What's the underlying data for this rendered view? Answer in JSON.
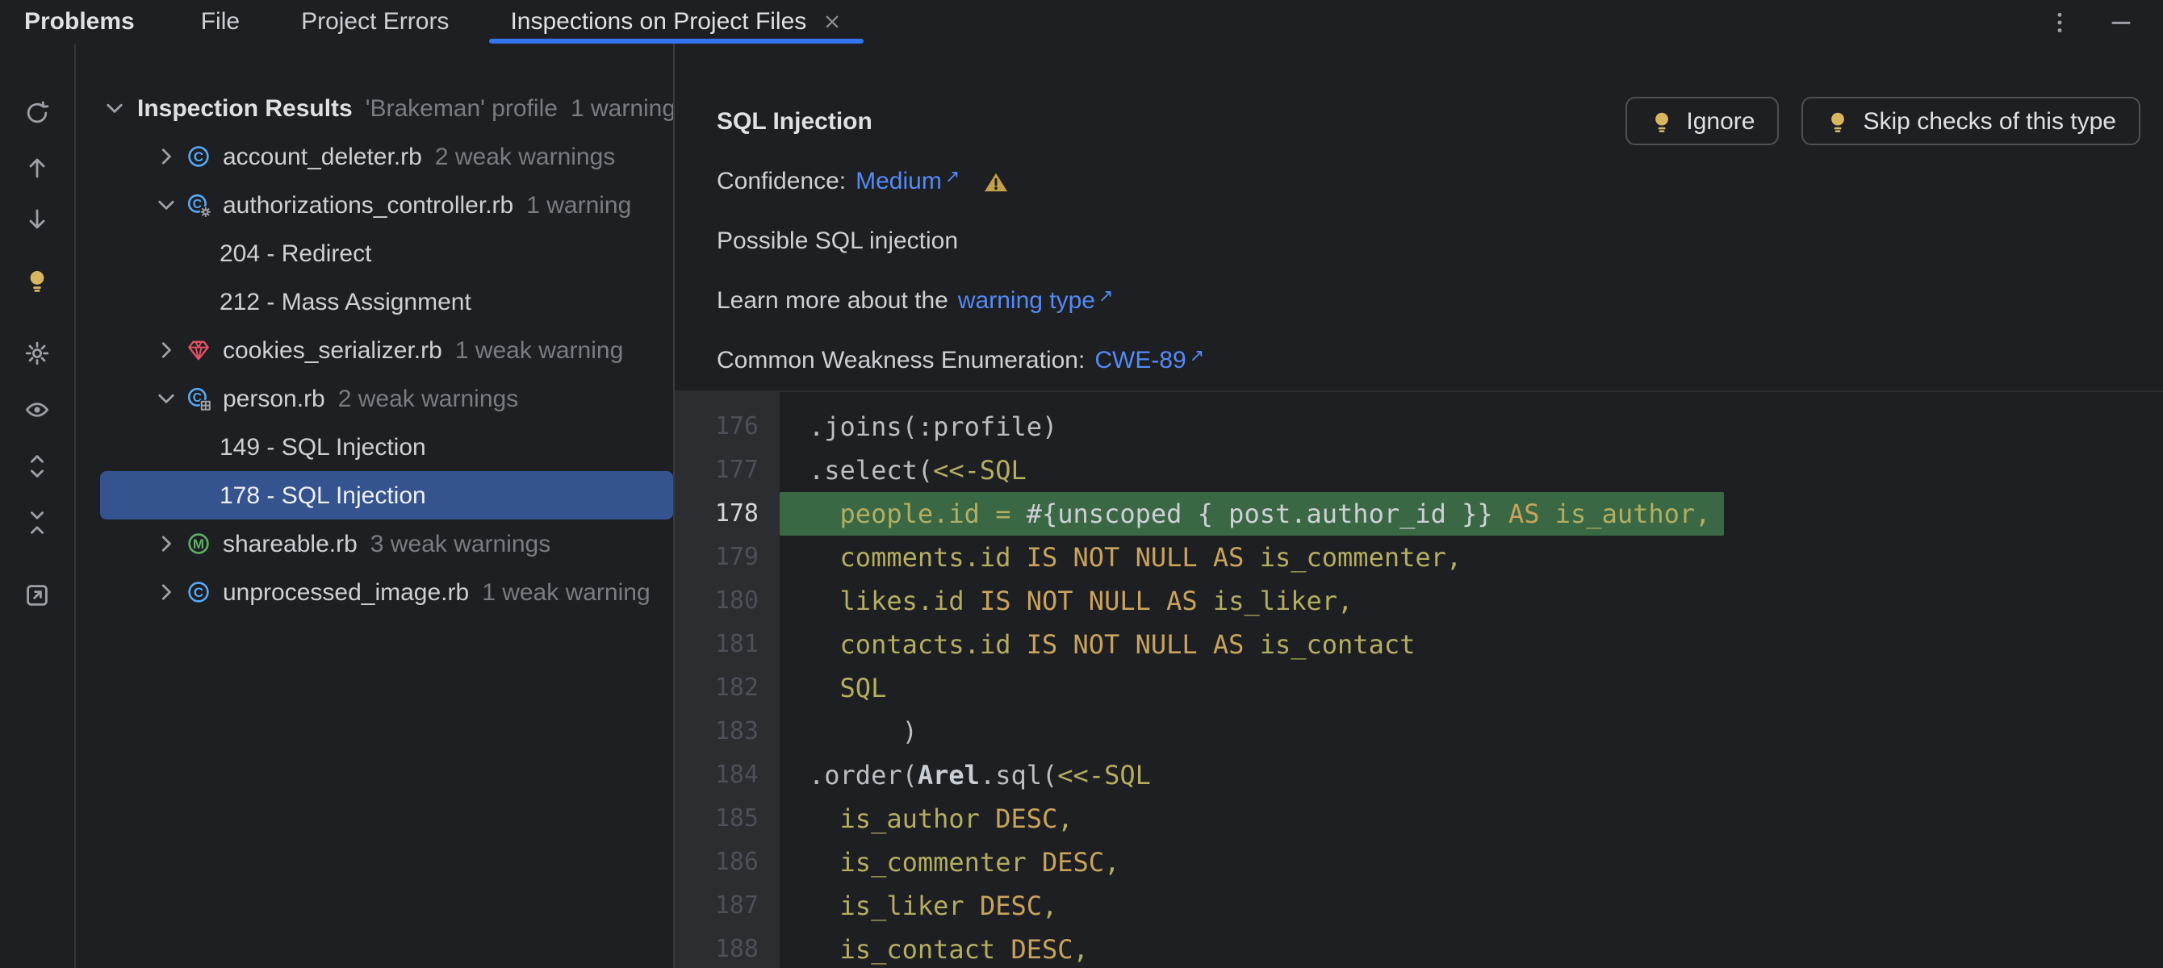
{
  "window": {
    "title": "Problems"
  },
  "tabs": [
    {
      "label": "File",
      "active": false
    },
    {
      "label": "Project Errors",
      "active": false
    },
    {
      "label": "Inspections on Project Files",
      "active": true,
      "closable": true
    }
  ],
  "window_controls": {
    "more": "kebab-menu",
    "hide": "minimize"
  },
  "toolbar": {
    "icons": [
      "refresh",
      "arrow-up",
      "arrow-down",
      "lightbulb",
      "settings",
      "preview",
      "expand-all",
      "collapse-all",
      "open-in-editor"
    ]
  },
  "tree": {
    "root": {
      "label": "Inspection Results",
      "profile": "'Brakeman' profile",
      "summary": "1 warning",
      "expanded": true
    },
    "files": [
      {
        "name": "account_deleter.rb",
        "icon": "ruby-class",
        "count": "2 weak warnings",
        "expanded": false,
        "children": []
      },
      {
        "name": "authorizations_controller.rb",
        "icon": "ruby-controller",
        "count": "1 warning",
        "expanded": true,
        "children": [
          {
            "label": "204 - Redirect"
          },
          {
            "label": "212 - Mass Assignment"
          }
        ]
      },
      {
        "name": "cookies_serializer.rb",
        "icon": "ruby-gem",
        "count": "1 weak warning",
        "expanded": false,
        "children": []
      },
      {
        "name": "person.rb",
        "icon": "ruby-model",
        "count": "2 weak warnings",
        "expanded": true,
        "children": [
          {
            "label": "149 - SQL Injection"
          },
          {
            "label": "178 - SQL Injection",
            "selected": true
          }
        ]
      },
      {
        "name": "shareable.rb",
        "icon": "ruby-module",
        "count": "3 weak warnings",
        "expanded": false,
        "children": []
      },
      {
        "name": "unprocessed_image.rb",
        "icon": "ruby-class",
        "count": "1 weak warning",
        "expanded": false,
        "children": []
      }
    ]
  },
  "details": {
    "title": "SQL Injection",
    "actions": [
      {
        "label": "Ignore",
        "icon": "lightbulb"
      },
      {
        "label": "Skip checks of this type",
        "icon": "lightbulb"
      }
    ],
    "confidence": {
      "label": "Confidence:",
      "value": "Medium",
      "external": "↗",
      "severity_icon": "weak-warning-triangle"
    },
    "message": "Possible SQL injection",
    "learn_more": {
      "prefix": "Learn more about the",
      "link": "warning type",
      "external": "↗"
    },
    "cwe": {
      "label": "Common Weakness Enumeration:",
      "link": "CWE-89",
      "external": "↗"
    }
  },
  "editor": {
    "lines": [
      {
        "no": 176,
        "segs": [
          [
            "d",
            ".joins(:profile)"
          ]
        ]
      },
      {
        "no": 177,
        "segs": [
          [
            "d",
            ".select("
          ],
          [
            "s",
            "<<-SQL"
          ]
        ]
      },
      {
        "no": 178,
        "hl": true,
        "segs": [
          [
            "s",
            "  people.id = "
          ],
          [
            "i",
            "#{unscoped { post.author_id }}"
          ],
          [
            "k",
            " AS"
          ],
          [
            "s",
            " is_author,"
          ]
        ]
      },
      {
        "no": 179,
        "segs": [
          [
            "s",
            "  comments.id "
          ],
          [
            "k",
            "IS NOT NULL AS"
          ],
          [
            "s",
            " is_commenter,"
          ]
        ]
      },
      {
        "no": 180,
        "segs": [
          [
            "s",
            "  likes.id "
          ],
          [
            "k",
            "IS NOT NULL AS"
          ],
          [
            "s",
            " is_liker,"
          ]
        ]
      },
      {
        "no": 181,
        "segs": [
          [
            "s",
            "  contacts.id "
          ],
          [
            "k",
            "IS NOT NULL AS"
          ],
          [
            "s",
            " is_contact"
          ]
        ]
      },
      {
        "no": 182,
        "segs": [
          [
            "s",
            "  SQL"
          ]
        ]
      },
      {
        "no": 183,
        "segs": [
          [
            "d",
            "      )"
          ]
        ]
      },
      {
        "no": 184,
        "segs": [
          [
            "d",
            ".order("
          ],
          [
            "c",
            "Arel"
          ],
          [
            "d",
            ".sql("
          ],
          [
            "s",
            "<<-SQL"
          ]
        ]
      },
      {
        "no": 185,
        "segs": [
          [
            "s",
            "  is_author "
          ],
          [
            "k",
            "DESC"
          ],
          [
            "s",
            ","
          ]
        ]
      },
      {
        "no": 186,
        "segs": [
          [
            "s",
            "  is_commenter "
          ],
          [
            "k",
            "DESC"
          ],
          [
            "s",
            ","
          ]
        ]
      },
      {
        "no": 187,
        "segs": [
          [
            "s",
            "  is_liker "
          ],
          [
            "k",
            "DESC"
          ],
          [
            "s",
            ","
          ]
        ]
      },
      {
        "no": 188,
        "segs": [
          [
            "s",
            "  is_contact "
          ],
          [
            "k",
            "DESC"
          ],
          [
            "s",
            ","
          ]
        ]
      }
    ]
  },
  "colors": {
    "panel_bg": "#1e1f22",
    "gutter_bg": "#2b2d30",
    "tab_underline": "#3574f0",
    "link": "#548af7",
    "selection": "#35538f",
    "highlight_green": "#3a6844",
    "code_default": "#bcbec4",
    "code_sql": "#b3ae60",
    "code_keyword": "#c9a35c",
    "warning_yellow": "#d9b55f",
    "gem_red": "#e05260",
    "class_blue": "#56a8f5",
    "module_green": "#5fad65"
  }
}
